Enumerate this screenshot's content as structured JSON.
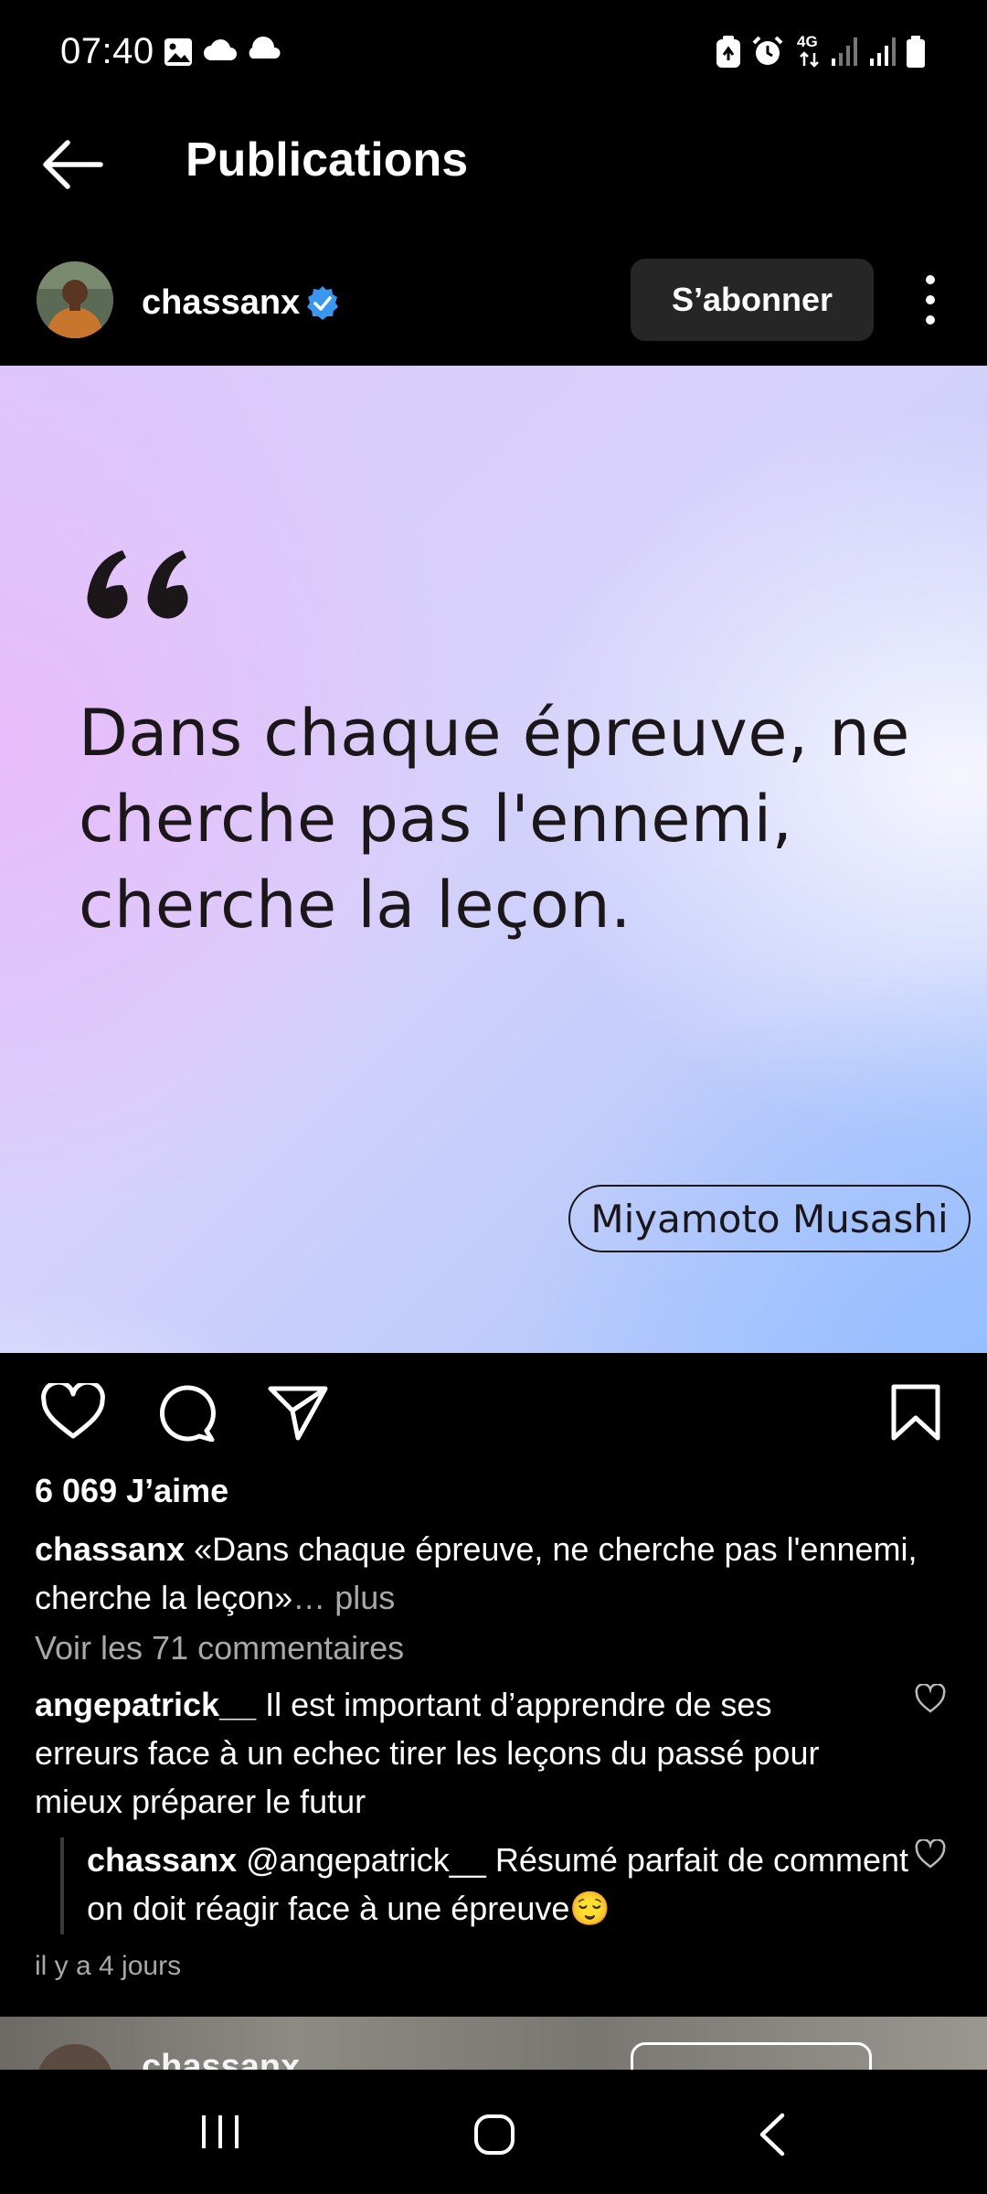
{
  "status_bar": {
    "time": "07:40",
    "left_icons": [
      "image-icon",
      "cloud-icon",
      "cloud-icon"
    ],
    "right_icons": [
      "battery-saver-icon",
      "alarm-icon",
      "4g-icon",
      "signal-icon",
      "signal-icon",
      "battery-icon"
    ],
    "network": "4G"
  },
  "header": {
    "title": "Publications",
    "back_icon": "arrow-left-icon"
  },
  "post": {
    "username": "chassanx",
    "verified": true,
    "follow_label": "S’abonner",
    "quote_text": "Dans chaque épreuve, ne cherche pas l'ennemi, cherche la leçon.",
    "quote_author": "Miyamoto Musashi",
    "likes": "6 069 J’aime",
    "caption_user": "chassanx",
    "caption_text": "«Dans chaque épreuve, ne cherche pas l'ennemi, cherche la leçon»",
    "caption_more": "… plus",
    "view_comments": "Voir les 71 commentaires",
    "comments": [
      {
        "user": "angepatrick__",
        "text": "Il est important d’apprendre de ses erreurs face à un echec tirer les leçons du passé pour mieux préparer le futur"
      },
      {
        "user": "chassanx",
        "text": "@angepatrick__ Résumé parfait de comment on doit réagir face à une épreuve😌"
      }
    ],
    "time_ago": "il y a 4 jours"
  },
  "next_post": {
    "username": "chassanx"
  },
  "colors": {
    "background": "#000000",
    "follow_button": "#262626",
    "muted_text": "#a8a8a8",
    "verified_blue": "#3897f0"
  }
}
